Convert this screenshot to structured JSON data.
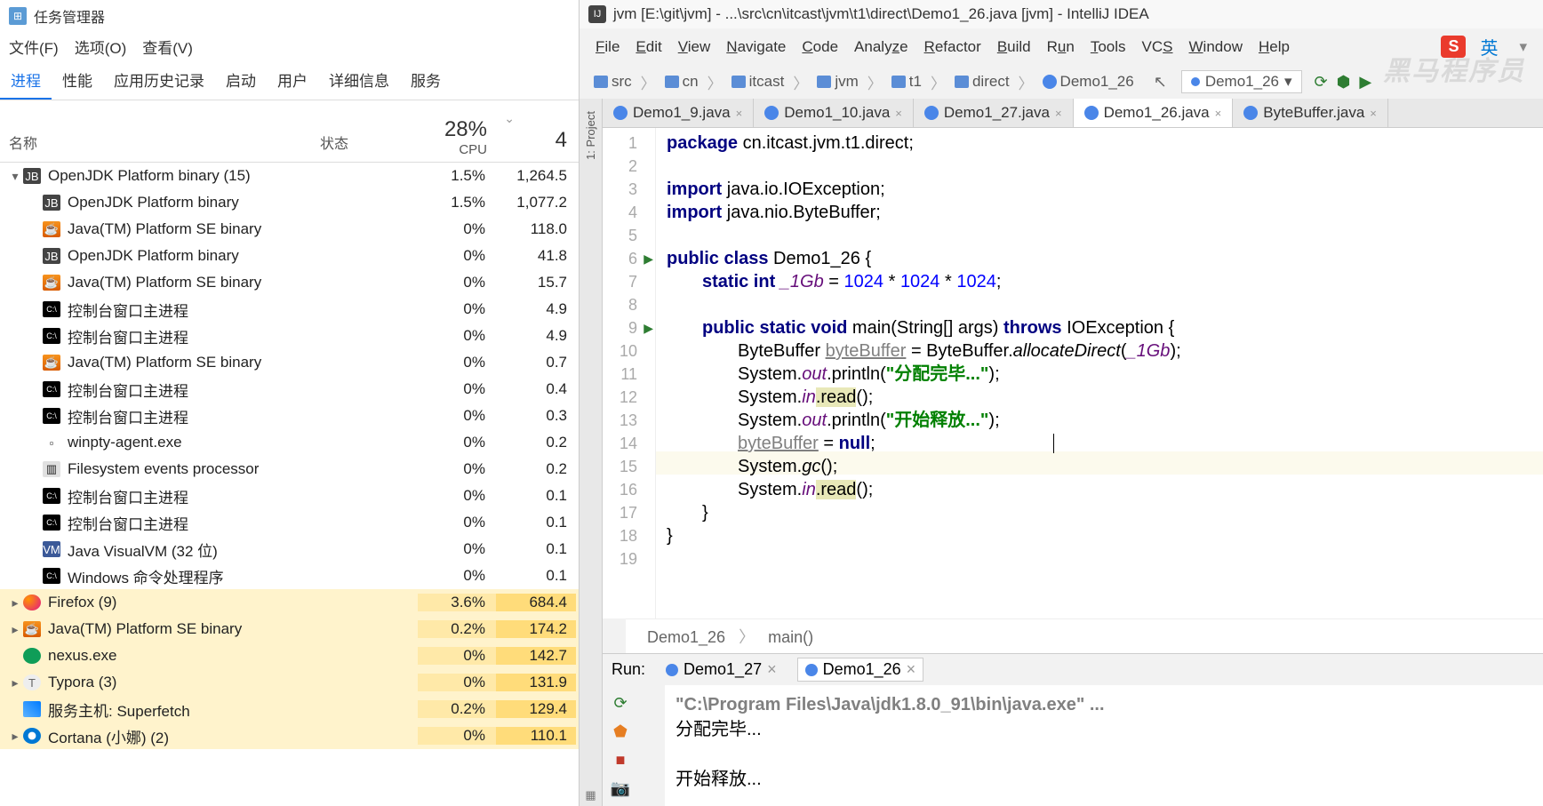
{
  "tm": {
    "title": "任务管理器",
    "menu": [
      "文件(F)",
      "选项(O)",
      "查看(V)"
    ],
    "tabs": [
      "进程",
      "性能",
      "应用历史记录",
      "启动",
      "用户",
      "详细信息",
      "服务"
    ],
    "cols": {
      "name": "名称",
      "status": "状态",
      "cpu_pct": "28%",
      "cpu_lbl": "CPU",
      "mem_pct": "4"
    },
    "rows": [
      {
        "exp": "▾",
        "indent": 0,
        "icon": "jb",
        "name": "OpenJDK Platform binary (15)",
        "cpu": "1.5%",
        "mem": "1,264.5",
        "hl": false
      },
      {
        "exp": "",
        "indent": 1,
        "icon": "jb",
        "name": "OpenJDK Platform binary",
        "cpu": "1.5%",
        "mem": "1,077.2",
        "hl": false
      },
      {
        "exp": "",
        "indent": 1,
        "icon": "java",
        "name": "Java(TM) Platform SE binary",
        "cpu": "0%",
        "mem": "118.0",
        "hl": false
      },
      {
        "exp": "",
        "indent": 1,
        "icon": "jb",
        "name": "OpenJDK Platform binary",
        "cpu": "0%",
        "mem": "41.8",
        "hl": false
      },
      {
        "exp": "",
        "indent": 1,
        "icon": "java",
        "name": "Java(TM) Platform SE binary",
        "cpu": "0%",
        "mem": "15.7",
        "hl": false
      },
      {
        "exp": "",
        "indent": 1,
        "icon": "cmd",
        "name": "控制台窗口主进程",
        "cpu": "0%",
        "mem": "4.9",
        "hl": false
      },
      {
        "exp": "",
        "indent": 1,
        "icon": "cmd",
        "name": "控制台窗口主进程",
        "cpu": "0%",
        "mem": "4.9",
        "hl": false
      },
      {
        "exp": "",
        "indent": 1,
        "icon": "java",
        "name": "Java(TM) Platform SE binary",
        "cpu": "0%",
        "mem": "0.7",
        "hl": false
      },
      {
        "exp": "",
        "indent": 1,
        "icon": "cmd",
        "name": "控制台窗口主进程",
        "cpu": "0%",
        "mem": "0.4",
        "hl": false
      },
      {
        "exp": "",
        "indent": 1,
        "icon": "cmd",
        "name": "控制台窗口主进程",
        "cpu": "0%",
        "mem": "0.3",
        "hl": false
      },
      {
        "exp": "",
        "indent": 1,
        "icon": "win",
        "name": "winpty-agent.exe",
        "cpu": "0%",
        "mem": "0.2",
        "hl": false
      },
      {
        "exp": "",
        "indent": 1,
        "icon": "fs",
        "name": "Filesystem events processor",
        "cpu": "0%",
        "mem": "0.2",
        "hl": false
      },
      {
        "exp": "",
        "indent": 1,
        "icon": "cmd",
        "name": "控制台窗口主进程",
        "cpu": "0%",
        "mem": "0.1",
        "hl": false
      },
      {
        "exp": "",
        "indent": 1,
        "icon": "cmd",
        "name": "控制台窗口主进程",
        "cpu": "0%",
        "mem": "0.1",
        "hl": false
      },
      {
        "exp": "",
        "indent": 1,
        "icon": "vvm",
        "name": "Java VisualVM (32 位)",
        "cpu": "0%",
        "mem": "0.1",
        "hl": false
      },
      {
        "exp": "",
        "indent": 1,
        "icon": "cmd",
        "name": "Windows 命令处理程序",
        "cpu": "0%",
        "mem": "0.1",
        "hl": false
      },
      {
        "exp": "▸",
        "indent": 0,
        "icon": "ff",
        "name": "Firefox (9)",
        "cpu": "3.6%",
        "mem": "684.4",
        "hl": true
      },
      {
        "exp": "▸",
        "indent": 0,
        "icon": "java",
        "name": "Java(TM) Platform SE binary",
        "cpu": "0.2%",
        "mem": "174.2",
        "hl": true
      },
      {
        "exp": "",
        "indent": 0,
        "icon": "nexus",
        "name": "nexus.exe",
        "cpu": "0%",
        "mem": "142.7",
        "hl": true
      },
      {
        "exp": "▸",
        "indent": 0,
        "icon": "typ",
        "name": "Typora (3)",
        "cpu": "0%",
        "mem": "131.9",
        "hl": true
      },
      {
        "exp": "",
        "indent": 0,
        "icon": "host",
        "name": "服务主机: Superfetch",
        "cpu": "0.2%",
        "mem": "129.4",
        "hl": true
      },
      {
        "exp": "▸",
        "indent": 0,
        "icon": "cortana",
        "name": "Cortana (小娜) (2)",
        "cpu": "0%",
        "mem": "110.1",
        "hl": true
      }
    ]
  },
  "ij": {
    "title": "jvm [E:\\git\\jvm] - ...\\src\\cn\\itcast\\jvm\\t1\\direct\\Demo1_26.java [jvm] - IntelliJ IDEA",
    "menu": [
      "File",
      "Edit",
      "View",
      "Navigate",
      "Code",
      "Analyze",
      "Refactor",
      "Build",
      "Run",
      "Tools",
      "VCS",
      "Window",
      "Help"
    ],
    "breadcrumb": [
      "src",
      "cn",
      "itcast",
      "jvm",
      "t1",
      "direct",
      "Demo1_26"
    ],
    "run_config": "Demo1_26",
    "tabs": [
      {
        "name": "Demo1_9.java",
        "active": false
      },
      {
        "name": "Demo1_10.java",
        "active": false
      },
      {
        "name": "Demo1_27.java",
        "active": false
      },
      {
        "name": "Demo1_26.java",
        "active": true
      },
      {
        "name": "ByteBuffer.java",
        "active": false
      }
    ],
    "code": {
      "l1_pkg": "package",
      "l1_rest": " cn.itcast.jvm.t1.direct;",
      "l3_imp": "import",
      "l3_rest": " java.io.IOException;",
      "l4_imp": "import",
      "l4_rest": " java.nio.ByteBuffer;",
      "l6_a": "public class",
      "l6_b": " Demo1_26 {",
      "l7_a": "static int ",
      "l7_b": "_1Gb",
      "l7_c": " = ",
      "l7_d": "1024",
      "l7_e": " * ",
      "l7_f": "1024",
      "l7_g": " * ",
      "l7_h": "1024",
      "l7_i": ";",
      "l9_a": "public static void",
      "l9_b": " main(String[] args) ",
      "l9_c": "throws",
      "l9_d": " IOException {",
      "l10_a": "ByteBuffer ",
      "l10_b": "byteBuffer",
      "l10_c": " = ByteBuffer.",
      "l10_d": "allocateDirect",
      "l10_e": "(",
      "l10_f": "_1Gb",
      "l10_g": ");",
      "l11_a": "System.",
      "l11_b": "out",
      "l11_c": ".println(",
      "l11_d": "\"分配完毕...\"",
      "l11_e": ");",
      "l12_a": "System.",
      "l12_b": "in",
      "l12_c": ".read",
      "l12_d": "();",
      "l13_a": "System.",
      "l13_b": "out",
      "l13_c": ".println(",
      "l13_d": "\"开始释放...\"",
      "l13_e": ");",
      "l14_a": "byteBuffer",
      "l14_b": " = ",
      "l14_c": "null",
      "l14_d": ";",
      "l15_a": "System.",
      "l15_b": "gc",
      "l15_c": "();",
      "l16_a": "System.",
      "l16_b": "in",
      "l16_c": ".read",
      "l16_d": "();",
      "l17": "}",
      "l18": "}"
    },
    "context": {
      "class": "Demo1_26",
      "method": "main()"
    },
    "run": {
      "label": "Run:",
      "tabs": [
        {
          "name": "Demo1_27",
          "active": false
        },
        {
          "name": "Demo1_26",
          "active": true
        }
      ],
      "path": "\"C:\\Program Files\\Java\\jdk1.8.0_91\\bin\\java.exe\" ...",
      "out1": "分配完毕...",
      "out2": "开始释放..."
    },
    "ime": "S",
    "ime_lang": "英"
  }
}
